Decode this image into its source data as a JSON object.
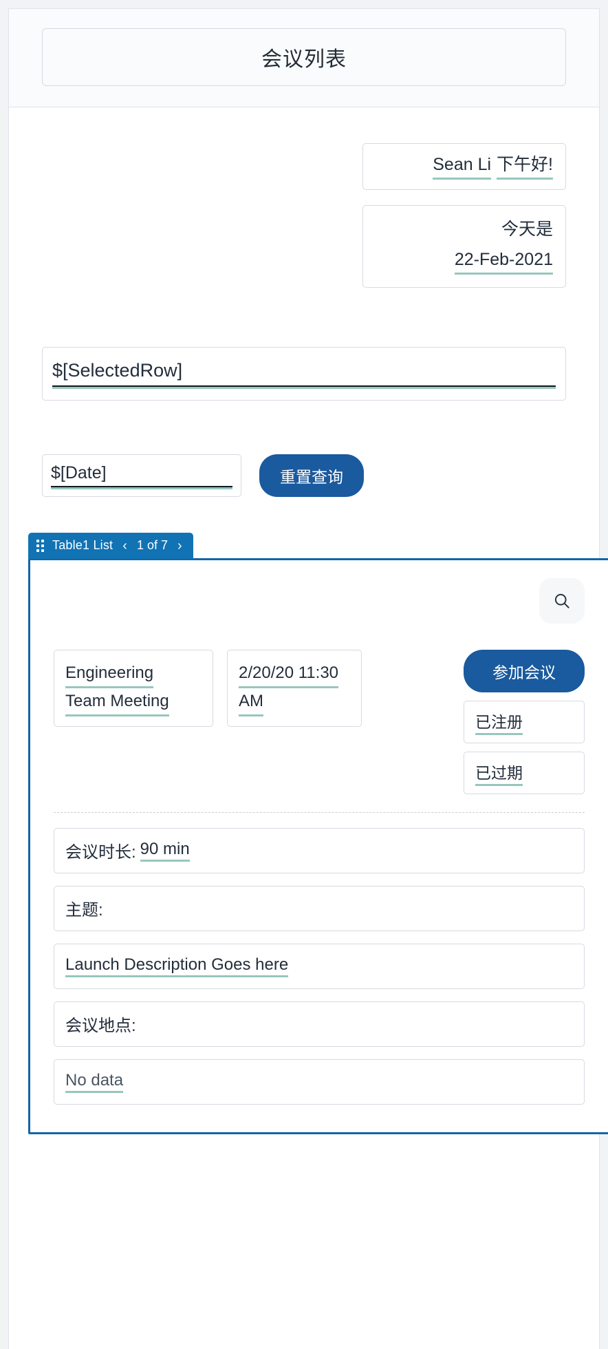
{
  "header": {
    "title": "会议列表"
  },
  "greeting": {
    "user_name": "Sean Li",
    "salutation": "下午好!"
  },
  "today": {
    "label": "今天是",
    "date": "22-Feb-2021"
  },
  "selected_row": {
    "value": "$[SelectedRow]"
  },
  "filters": {
    "date_value": "$[Date]",
    "reset_label": "重置查询"
  },
  "list": {
    "tab_label": "Table1 List",
    "prev_icon": "‹",
    "next_icon": "›",
    "pager_text": "1 of 7",
    "search_icon": "search-icon"
  },
  "record": {
    "title_lines": [
      "Engineering",
      "Team Meeting"
    ],
    "datetime_lines": [
      "2/20/20 11:30",
      "AM"
    ],
    "join_label": "参加会议",
    "badges": [
      "已注册",
      "已过期"
    ]
  },
  "details": [
    {
      "label": "会议时长:",
      "value": "90 min",
      "muted": false
    },
    {
      "label": "主题:",
      "value": "",
      "muted": false
    },
    {
      "label": "",
      "value": "Launch Description Goes here",
      "muted": false
    },
    {
      "label": "会议地点:",
      "value": "",
      "muted": false
    },
    {
      "label": "",
      "value": "No data",
      "muted": true
    }
  ],
  "colors": {
    "primary_blue": "#1a5a9e",
    "tab_blue": "#1173b4",
    "card_border_blue": "#1266a8",
    "underline_teal": "#97c7bc",
    "page_bg": "#f2f3f5",
    "box_border": "#d5dae0"
  }
}
